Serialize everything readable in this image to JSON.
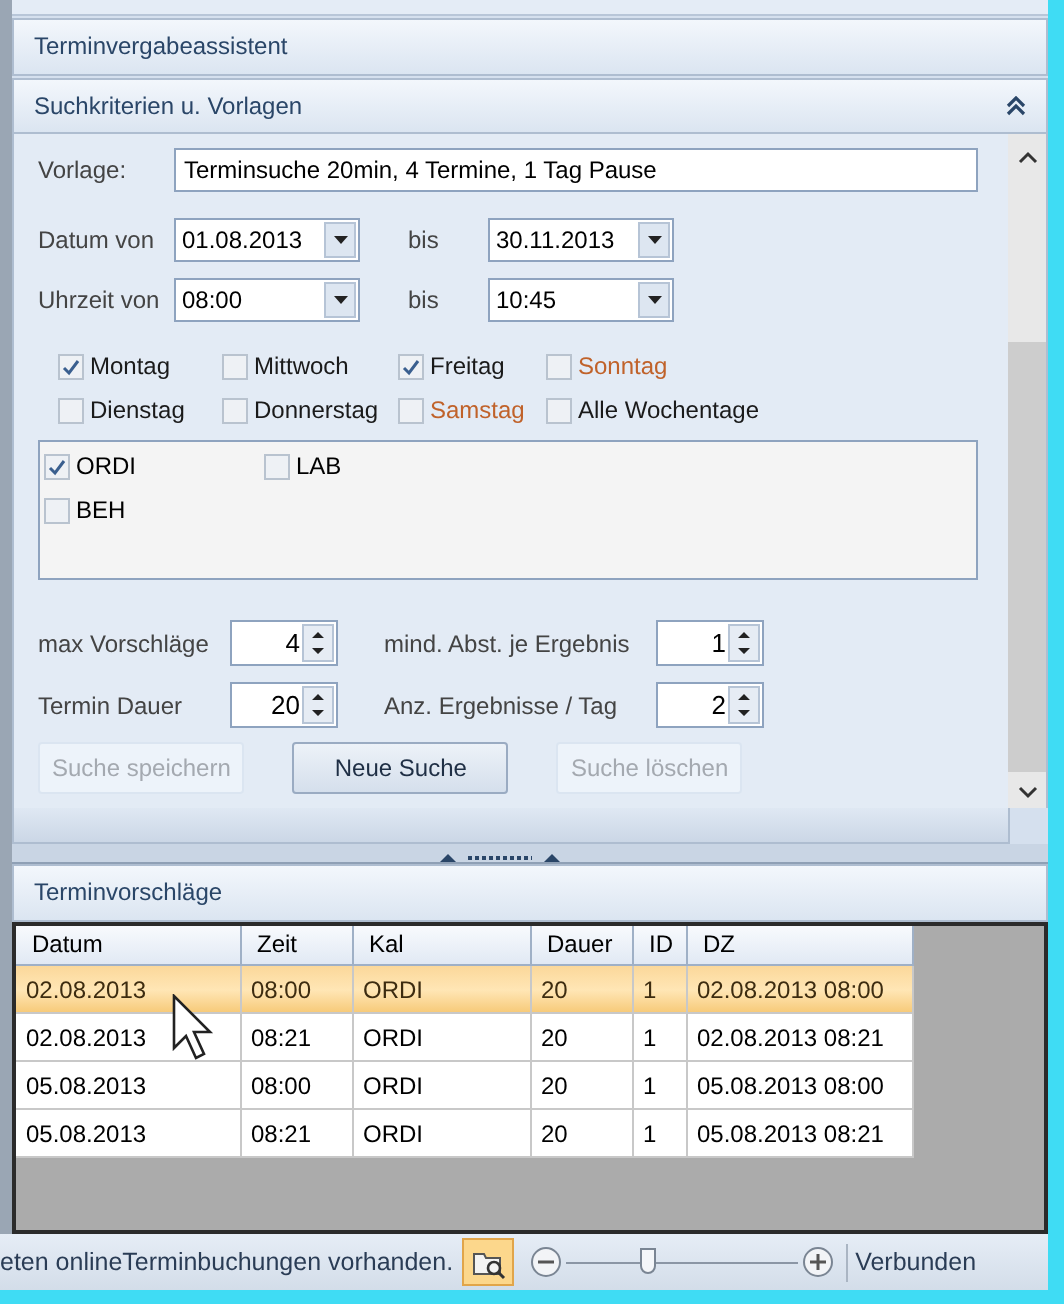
{
  "panels": [
    {
      "title": "Terminvergabeassistent"
    },
    {
      "title": "Suchkriterien u. Vorlagen",
      "expanded": true
    }
  ],
  "template": {
    "label": "Vorlage:",
    "value": "Terminsuche 20min, 4 Termine, 1 Tag Pause"
  },
  "date_row": {
    "label": "Datum von",
    "from": "01.08.2013",
    "to_label": "bis",
    "to": "30.11.2013"
  },
  "time_row": {
    "label": "Uhrzeit von",
    "from": "08:00",
    "to_label": "bis",
    "to": "10:45"
  },
  "weekdays": [
    {
      "label": "Montag",
      "checked": true,
      "color": "#1a1a1a"
    },
    {
      "label": "Mittwoch",
      "checked": false,
      "color": "#1a1a1a"
    },
    {
      "label": "Freitag",
      "checked": true,
      "color": "#1a1a1a"
    },
    {
      "label": "Sonntag",
      "checked": false,
      "color": "#c0622a"
    },
    {
      "label": "Dienstag",
      "checked": false,
      "color": "#1a1a1a"
    },
    {
      "label": "Donnerstag",
      "checked": false,
      "color": "#1a1a1a"
    },
    {
      "label": "Samstag",
      "checked": false,
      "color": "#c0622a"
    },
    {
      "label": "Alle Wochentage",
      "checked": false,
      "color": "#1a1a1a"
    }
  ],
  "calendars": [
    {
      "label": "ORDI",
      "checked": true
    },
    {
      "label": "LAB",
      "checked": false
    },
    {
      "label": "BEH",
      "checked": false
    }
  ],
  "spinners": [
    {
      "label": "max Vorschläge",
      "value": "4"
    },
    {
      "label": "mind. Abst. je Ergebnis",
      "value": "1"
    },
    {
      "label": "Termin Dauer",
      "value": "20"
    },
    {
      "label": "Anz. Ergebnisse / Tag",
      "value": "2"
    }
  ],
  "buttons": [
    {
      "label": "Suche speichern",
      "disabled": true
    },
    {
      "label": "Neue Suche",
      "disabled": false
    },
    {
      "label": "Suche löschen",
      "disabled": true
    }
  ],
  "results": {
    "title": "Terminvorschläge",
    "columns": [
      "Datum",
      "Zeit",
      "Kal",
      "Dauer",
      "ID",
      "DZ"
    ],
    "rows": [
      {
        "cells": [
          "02.08.2013",
          "08:00",
          "ORDI",
          "20",
          "1",
          "02.08.2013 08:00"
        ],
        "selected": true
      },
      {
        "cells": [
          "02.08.2013",
          "08:21",
          "ORDI",
          "20",
          "1",
          "02.08.2013 08:21"
        ],
        "selected": false
      },
      {
        "cells": [
          "05.08.2013",
          "08:00",
          "ORDI",
          "20",
          "1",
          "05.08.2013 08:00"
        ],
        "selected": false
      },
      {
        "cells": [
          "05.08.2013",
          "08:21",
          "ORDI",
          "20",
          "1",
          "05.08.2013 08:21"
        ],
        "selected": false
      }
    ]
  },
  "status_bar": {
    "message": "eten onlineTerminbuchungen vorhanden.",
    "zoom_slider": {
      "level": 0.35
    },
    "connection": "Verbunden"
  }
}
